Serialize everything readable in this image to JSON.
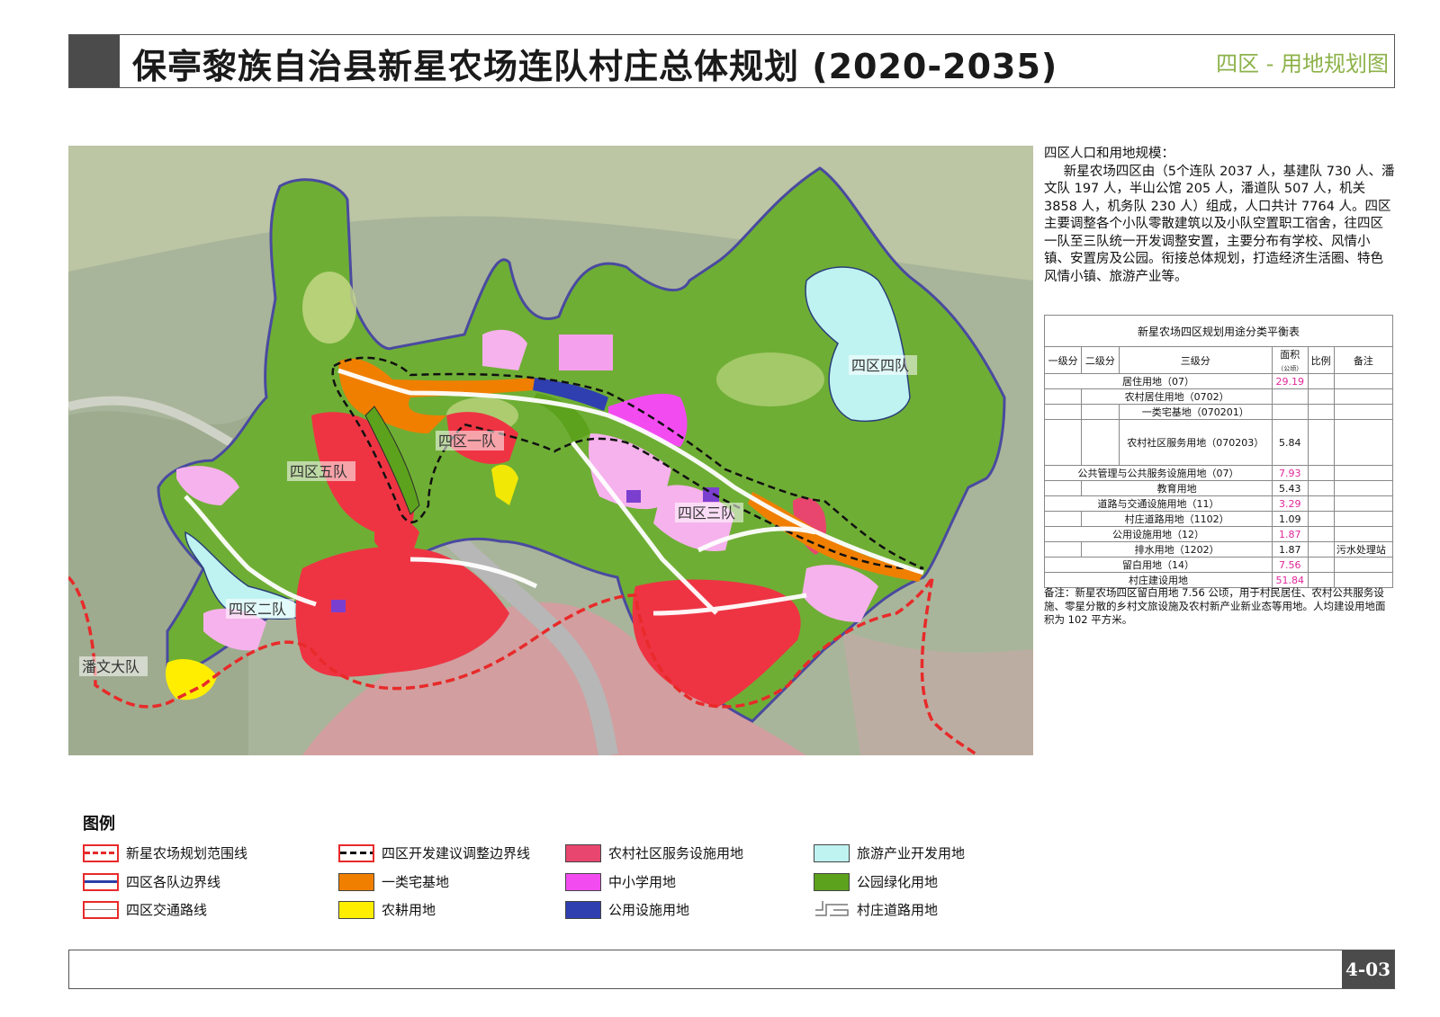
{
  "header": {
    "title": "保亭黎族自治县新星农场连队村庄总体规划 (2020-2035)",
    "subtitle": "四区 - 用地规划图"
  },
  "map": {
    "labels": {
      "team4": "四区四队",
      "team1": "四区一队",
      "team5": "四区五队",
      "team3": "四区三队",
      "team2": "四区二队",
      "panwen": "潘文大队"
    }
  },
  "description": {
    "heading": "四区人口和用地规模：",
    "body": "新星农场四区由（5个连队 2037 人，基建队 730 人、潘文队 197 人，半山公馆 205 人，潘道队 507 人，机关 3858 人，机务队 230 人）组成，人口共计 7764 人。四区主要调整各个小队零散建筑以及小队空置职工宿舍，往四区一队至三队统一开发调整安置，主要分布有学校、风情小镇、安置房及公园。衔接总体规划，打造经济生活圈、特色风情小镇、旅游产业等。"
  },
  "table": {
    "caption": "新星农场四区规划用途分类平衡表",
    "headers": {
      "level1": "一级分",
      "level2": "二级分",
      "level3": "三级分",
      "area": "面积",
      "area_unit": "（公顷）",
      "ratio": "比例",
      "remark": "备注"
    },
    "rows": [
      {
        "name": "居住用地（07）",
        "area": "29.19",
        "remark": ""
      },
      {
        "name": "农村居住用地（0702）",
        "area": "",
        "remark": ""
      },
      {
        "name": "一类宅基地（070201）",
        "area": "",
        "remark": ""
      },
      {
        "name": "农村社区服务用地（070203）",
        "area": "5.84",
        "remark": ""
      },
      {
        "name": "公共管理与公共服务设施用地（07）",
        "area": "7.93",
        "remark": ""
      },
      {
        "name": "教育用地",
        "area": "5.43",
        "remark": ""
      },
      {
        "name": "道路与交通设施用地（11）",
        "area": "3.29",
        "remark": ""
      },
      {
        "name": "村庄道路用地（1102）",
        "area": "1.09",
        "remark": ""
      },
      {
        "name": "公用设施用地（12）",
        "area": "1.87",
        "remark": ""
      },
      {
        "name": "排水用地（1202）",
        "area": "1.87",
        "remark": "污水处理站"
      },
      {
        "name": "留白用地（14）",
        "area": "7.56",
        "remark": ""
      },
      {
        "name": "村庄建设用地",
        "area": "51.84",
        "remark": ""
      }
    ]
  },
  "note": "备注：新星农场四区留白用地 7.56 公顷，用于村民居住、农村公共服务设施、零星分散的乡村文旅设施及农村新产业新业态等用地。人均建设用地面积为 102 平方米。",
  "legend": {
    "title": "图例",
    "items": [
      {
        "label": "新星农场规划范围线",
        "icon": "red-dashed-boundary"
      },
      {
        "label": "四区开发建议调整边界线",
        "icon": "black-dashed-boundary"
      },
      {
        "label": "农村社区服务设施用地",
        "icon": "swatch",
        "color": "#e8466e"
      },
      {
        "label": "旅游产业开发用地",
        "icon": "swatch",
        "color": "#bff3f2"
      },
      {
        "label": "四区各队边界线",
        "icon": "blue-line"
      },
      {
        "label": "一类宅基地",
        "icon": "swatch",
        "color": "#f07f00"
      },
      {
        "label": "中小学用地",
        "icon": "swatch",
        "color": "#f24cf0"
      },
      {
        "label": "公园绿化用地",
        "icon": "swatch",
        "color": "#5da21c"
      },
      {
        "label": "四区交通路线",
        "icon": "road-line"
      },
      {
        "label": "农耕用地",
        "icon": "swatch",
        "color": "#ffee00"
      },
      {
        "label": "公用设施用地",
        "icon": "swatch",
        "color": "#2f3fb0"
      },
      {
        "label": "村庄道路用地",
        "icon": "village-road"
      }
    ]
  },
  "footer": {
    "page": "4-03"
  },
  "colors": {
    "residential": "#ee3443",
    "park_green": "#5da21c",
    "school": "#f24cf0",
    "tourism": "#bff3f2",
    "homestead": "#f07f00",
    "farming": "#ffee00",
    "utility": "#2f3fb0",
    "community": "#e8466e",
    "pink_land": "#f6b2ec"
  }
}
